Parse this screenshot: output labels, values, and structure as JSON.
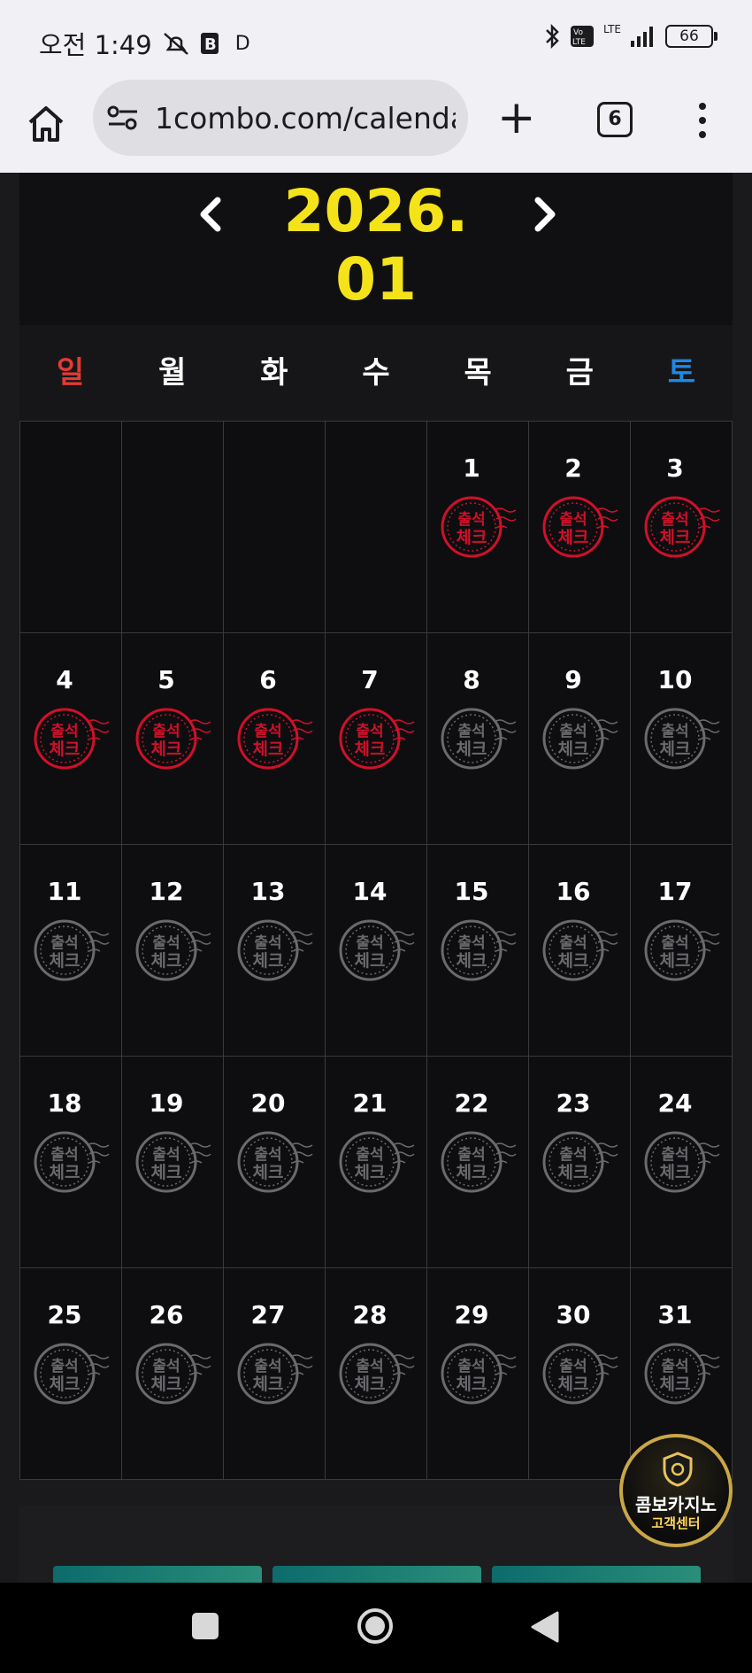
{
  "status_bar": {
    "time": "오전 1:49",
    "extra": "D",
    "battery": "66",
    "network": "LTE"
  },
  "browser": {
    "url": "1combo.com/calenda",
    "tab_count": "6"
  },
  "calendar": {
    "month_title": "2026. 01",
    "weekdays": [
      "일",
      "월",
      "화",
      "수",
      "목",
      "금",
      "토"
    ],
    "leading_blanks": 4,
    "days": [
      "1",
      "2",
      "3",
      "4",
      "5",
      "6",
      "7",
      "8",
      "9",
      "10",
      "11",
      "12",
      "13",
      "14",
      "15",
      "16",
      "17",
      "18",
      "19",
      "20",
      "21",
      "22",
      "23",
      "24",
      "25",
      "26",
      "27",
      "28",
      "29",
      "30",
      "31"
    ],
    "checked_days": [
      1,
      2,
      3,
      4,
      5,
      6,
      7
    ],
    "stamp_text": [
      "출석",
      "체크"
    ],
    "colors": {
      "title": "#f5e31a",
      "sunday": "#e53935",
      "saturday": "#1e88e5",
      "stamp_checked": "#d0102a",
      "stamp_unchecked": "#6a6a6e"
    }
  },
  "float_button": {
    "line1": "콤보카지노",
    "line2": "고객센터"
  }
}
